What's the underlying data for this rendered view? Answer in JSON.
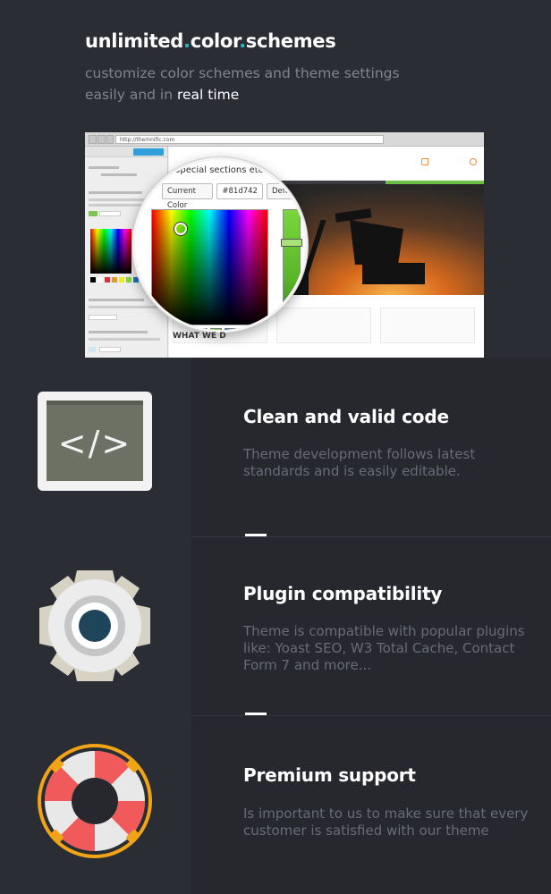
{
  "header": {
    "title_part1": "unlimited",
    "title_dot": ".",
    "title_part2": "color",
    "title_part3": "schemes",
    "subtitle_line1": "customize color schemes and theme settings",
    "subtitle_line2": "easily and in ",
    "subtitle_highlight": "real time"
  },
  "screenshot": {
    "url": "http://themnific.com",
    "magnifier_text": "Special sections etc.",
    "current_color_label": "Current Color",
    "current_color_value": "#81d742",
    "default_label": "Default",
    "section_heading": "WHAT WE D",
    "colors": {
      "picker_strip": "#6cc04a",
      "nav_accent": "#6cc04a",
      "contact_icon": "#f28c38"
    }
  },
  "features": [
    {
      "title": "Clean and valid code",
      "description": "Theme development follows latest standards and is easily editable.",
      "icon": "code-icon",
      "icon_glyph": "</>"
    },
    {
      "title": "Plugin compatibility",
      "description": "Theme is compatible with popular plugins like: Yoast SEO, W3 Total Cache, Contact Form 7 and more...",
      "icon": "gear-icon"
    },
    {
      "title": "Premium support",
      "description": "Is important to us to make sure that every customer is satisfied with our theme",
      "icon": "lifebuoy-icon"
    }
  ],
  "colors": {
    "background": "#2b2d34",
    "accent_dot": "#2bb3c0",
    "text_muted": "#80848e",
    "heading": "#ffffff"
  }
}
